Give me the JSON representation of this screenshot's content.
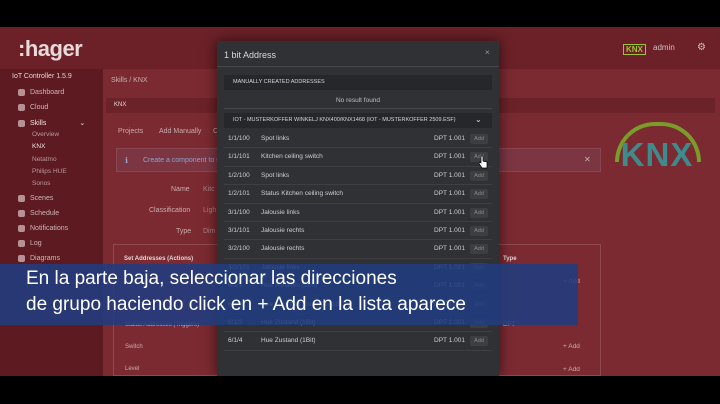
{
  "app": {
    "brand": ":hager",
    "controller_title": "IoT Controller 1.5.9",
    "user": "admin",
    "knx_badge": "KNX"
  },
  "sidebar": {
    "items": [
      {
        "label": "Dashboard"
      },
      {
        "label": "Cloud"
      },
      {
        "label": "Skills"
      },
      {
        "label": "Scenes"
      },
      {
        "label": "Schedule"
      },
      {
        "label": "Notifications"
      },
      {
        "label": "Log"
      },
      {
        "label": "Diagrams"
      }
    ],
    "skills_sub": [
      "Overview",
      "KNX",
      "Netatmo",
      "Philips HUE",
      "Sonos"
    ]
  },
  "main": {
    "breadcrumb": "Skills  /  KNX",
    "card_title": "KNX",
    "tabs": [
      "Projects",
      "Add Manually",
      "C"
    ],
    "info_text": "Create a component to s",
    "fields": [
      {
        "label": "Name",
        "value": "Kitc"
      },
      {
        "label": "Classification",
        "value": "Ligh"
      },
      {
        "label": "Type",
        "value": "Dim"
      }
    ],
    "section_title": "Set Addresses (Actions)",
    "type_col": "Type",
    "section_rows": [
      "Status Addresses (Triggers)",
      "Switch",
      "Level"
    ],
    "side_dpt": "DPT",
    "add_label": "+ Add"
  },
  "modal": {
    "title": "1 bit Address",
    "close": "×",
    "manual_header": "MANUALLY CREATED ADDRESSES",
    "no_result": "No result found",
    "project_select": "IOT - MUSTERKOFFER WINKELJ KNX400/KNX1468 (IOT - MUSTERKOFFER 2509.ESF)",
    "rows": [
      {
        "addr": "1/1/100",
        "name": "Spot links",
        "dpt": "DPT 1.001",
        "action": "Add"
      },
      {
        "addr": "1/1/101",
        "name": "Kitchen ceiling switch",
        "dpt": "DPT 1.001",
        "action": "Add"
      },
      {
        "addr": "1/2/100",
        "name": "Spot links",
        "dpt": "DPT 1.001",
        "action": "Add"
      },
      {
        "addr": "1/2/101",
        "name": "Status Kitchen ceiling switch",
        "dpt": "DPT 1.001",
        "action": "Add"
      },
      {
        "addr": "3/1/100",
        "name": "Jalousie links",
        "dpt": "DPT 1.001",
        "action": "Add"
      },
      {
        "addr": "3/1/101",
        "name": "Jalousie rechts",
        "dpt": "DPT 1.001",
        "action": "Add"
      },
      {
        "addr": "3/2/100",
        "name": "Jalousie rechts",
        "dpt": "DPT 1.001",
        "action": "Add"
      },
      {
        "addr": "3/2/101",
        "name": "Jalousie links",
        "dpt": "DPT 1.001",
        "action": "Add"
      },
      {
        "addr": "6/1/1",
        "name": "Hue Schalten (1Bit)",
        "dpt": "DPT 1.001",
        "action": "Add"
      },
      {
        "addr": "6/1/2",
        "name": "Hue Schalten Ein / Aus (1Bit)",
        "dpt": "DPT 1.001",
        "action": "Add"
      },
      {
        "addr": "6/1/3",
        "name": "Hue Zustand (1Bit)",
        "dpt": "DPT 1.001",
        "action": "Add"
      },
      {
        "addr": "6/1/4",
        "name": "Hue Zustand (1Bit)",
        "dpt": "DPT 1.001",
        "action": "Add"
      }
    ]
  },
  "knx_logo": {
    "text": "KNX",
    "arc_color": "#7a9c2b",
    "text_color": "#3f8a8c"
  },
  "subtitle": {
    "line1": "En la parte baja, seleccionar las direcciones",
    "line2": "de grupo haciendo click en + Add en la lista aparece"
  },
  "colors": {
    "accent": "#6b2127",
    "modal_bg": "#303134",
    "subtitle_bg": "#203c80"
  }
}
